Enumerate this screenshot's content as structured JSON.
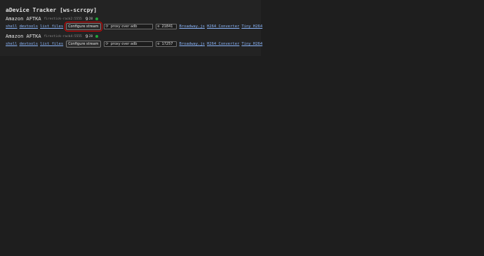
{
  "title": "aDevice Tracker [ws-scrcpy]",
  "devices": [
    {
      "name": "Amazon AFTKA",
      "serial": "firestick-rack2:5555",
      "sdk_major": "9",
      "sdk_api": "28",
      "status_color": "#22a83a",
      "links": {
        "shell": "shell",
        "devtools": "devtools",
        "list_files": "list files"
      },
      "configure_label": "Configure stream",
      "proxy_label": "proxy over adb",
      "port": "21841",
      "players": {
        "broadway": "Broadway.js",
        "h264": "H264 Converter",
        "tiny": "Tiny H264"
      },
      "highlighted": true
    },
    {
      "name": "Amazon AFTKA",
      "serial": "firestick-rack4:5555",
      "sdk_major": "9",
      "sdk_api": "28",
      "status_color": "#22a83a",
      "links": {
        "shell": "shell",
        "devtools": "devtools",
        "list_files": "list files"
      },
      "configure_label": "Configure stream",
      "proxy_label": "proxy over adb",
      "port": "17257",
      "players": {
        "broadway": "Broadway.js",
        "h264": "H264 Converter",
        "tiny": "Tiny H264"
      },
      "highlighted": false
    }
  ],
  "icons": {
    "proxy": "refresh-icon",
    "port": "gear-icon"
  }
}
